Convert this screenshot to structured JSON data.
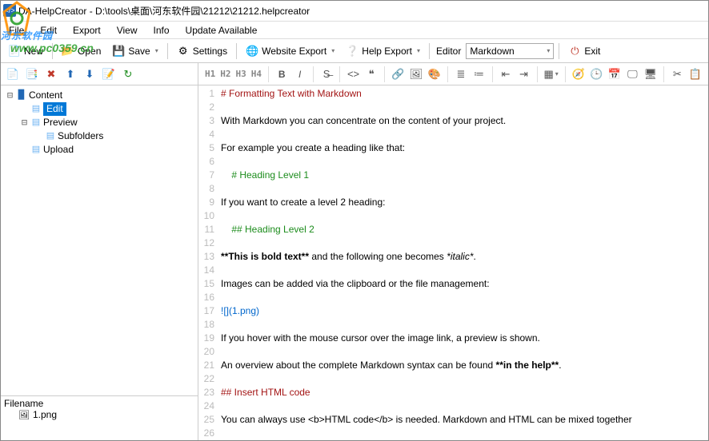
{
  "title": "DA-HelpCreator - D:\\tools\\桌面\\河东软件园\\21212\\21212.helpcreator",
  "watermark": {
    "line1": "河东软件园",
    "line2": "www.pc0359.cn"
  },
  "menu": [
    "File",
    "Edit",
    "Export",
    "View",
    "Info",
    "Update Available"
  ],
  "toolbar": {
    "new": "New",
    "open": "Open",
    "save": "Save",
    "settings": "Settings",
    "website_export": "Website Export",
    "help_export": "Help Export",
    "editor_label": "Editor",
    "editor_value": "Markdown",
    "exit": "Exit"
  },
  "tree": {
    "root": "Content",
    "edit": "Edit",
    "preview": "Preview",
    "subfolders": "Subfolders",
    "upload": "Upload"
  },
  "filepanel": {
    "label": "Filename",
    "item": "1.png"
  },
  "headings": {
    "h1": "H1",
    "h2": "H2",
    "h3": "H3",
    "h4": "H4"
  },
  "code_lines": [
    {
      "n": 1,
      "cls": "c-h",
      "t": "# Formatting Text with Markdown"
    },
    {
      "n": 2,
      "cls": "",
      "t": ""
    },
    {
      "n": 3,
      "cls": "",
      "t": "With Markdown you can concentrate on the content of your project."
    },
    {
      "n": 4,
      "cls": "",
      "t": ""
    },
    {
      "n": 5,
      "cls": "",
      "t": "For example you create a heading like that:"
    },
    {
      "n": 6,
      "cls": "",
      "t": ""
    },
    {
      "n": 7,
      "cls": "c-kw",
      "t": "    # Heading Level 1"
    },
    {
      "n": 8,
      "cls": "",
      "t": ""
    },
    {
      "n": 9,
      "cls": "",
      "t": "If you want to create a level 2 heading:"
    },
    {
      "n": 10,
      "cls": "",
      "t": ""
    },
    {
      "n": 11,
      "cls": "c-kw",
      "t": "    ## Heading Level 2"
    },
    {
      "n": 12,
      "cls": "",
      "t": ""
    },
    {
      "n": 13,
      "cls": "mix",
      "parts": [
        {
          "cls": "c-b",
          "t": "**This is bold text**"
        },
        {
          "cls": "",
          "t": " and the following one becomes "
        },
        {
          "cls": "c-it",
          "t": "*italic*"
        },
        {
          "cls": "",
          "t": "."
        }
      ]
    },
    {
      "n": 14,
      "cls": "",
      "t": ""
    },
    {
      "n": 15,
      "cls": "",
      "t": "Images can be added via the clipboard or the file management:"
    },
    {
      "n": 16,
      "cls": "",
      "t": ""
    },
    {
      "n": 17,
      "cls": "c-lnk",
      "t": "![](1.png)"
    },
    {
      "n": 18,
      "cls": "",
      "t": ""
    },
    {
      "n": 19,
      "cls": "",
      "t": "If you hover with the mouse cursor over the image link, a preview is shown."
    },
    {
      "n": 20,
      "cls": "",
      "t": ""
    },
    {
      "n": 21,
      "cls": "mix",
      "parts": [
        {
          "cls": "",
          "t": "An overview about the complete Markdown syntax can be found "
        },
        {
          "cls": "c-b",
          "t": "**in the help**"
        },
        {
          "cls": "",
          "t": "."
        }
      ]
    },
    {
      "n": 22,
      "cls": "",
      "t": ""
    },
    {
      "n": 23,
      "cls": "c-red",
      "t": "## Insert HTML code"
    },
    {
      "n": 24,
      "cls": "",
      "t": ""
    },
    {
      "n": 25,
      "cls": "",
      "t": "You can always use <b>HTML code</b> is needed. Markdown and HTML can be mixed together"
    },
    {
      "n": 26,
      "cls": "",
      "t": ""
    }
  ]
}
